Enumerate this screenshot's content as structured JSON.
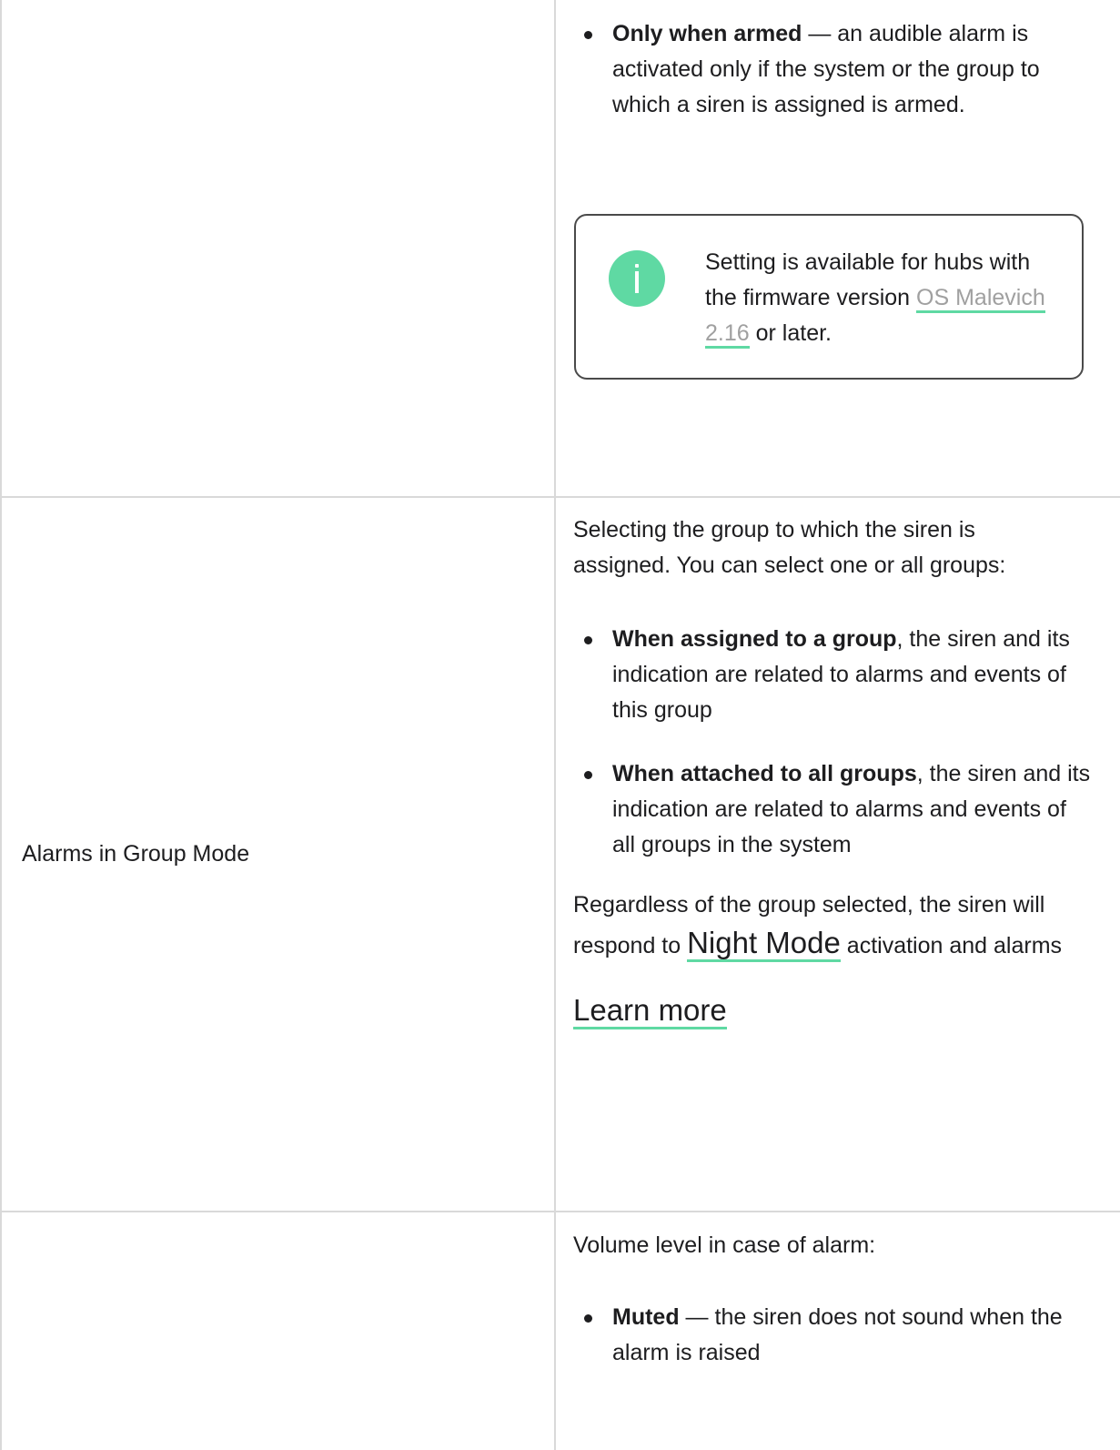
{
  "row1": {
    "armed_bullet": {
      "bold": "Only when armed",
      "rest": " — an audible alarm is activated only if the system or the group to which a siren is assigned is armed."
    },
    "info": {
      "text_before": "Setting is available for hubs with the firmware version ",
      "link": "OS Malevich 2.16",
      "text_after": " or later."
    }
  },
  "row2": {
    "label": "Alarms in Group Mode",
    "intro": "Selecting the group to which the siren is assigned. You can select one or all groups:",
    "bullets": [
      {
        "bold": "When assigned to a group",
        "rest": ", the siren and its indication are related to alarms and events of this group"
      },
      {
        "bold": "When attached to all groups",
        "rest": ", the siren and its indication are related to alarms and events of all groups in the system"
      }
    ],
    "note_before": "Regardless of the group selected, the siren will respond to ",
    "note_link": "Night Mode",
    "note_after": " activation and alarms",
    "learn_more": "Learn more"
  },
  "row3": {
    "intro": "Volume level in case of alarm:",
    "bullets": [
      {
        "bold": "Muted",
        "rest": " — the siren does not sound when the alarm is raised"
      }
    ]
  },
  "colors": {
    "accent": "#5fd9a3",
    "link_gray": "#a0a0a0",
    "border": "#d9d9d9",
    "text": "#1d1d1f"
  }
}
